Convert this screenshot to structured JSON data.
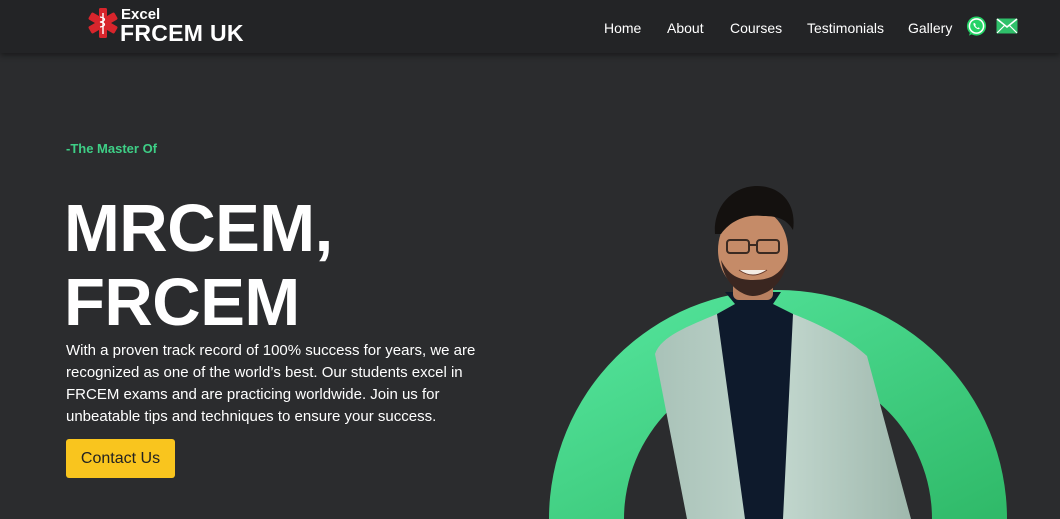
{
  "brand": {
    "line1": "Excel",
    "line2": "FRCEM UK"
  },
  "nav": {
    "items": [
      {
        "label": "Home",
        "name": "nav-home"
      },
      {
        "label": "About",
        "name": "nav-about"
      },
      {
        "label": "Courses",
        "name": "nav-courses"
      },
      {
        "label": "Testimonials",
        "name": "nav-testimonials"
      },
      {
        "label": "Gallery",
        "name": "nav-gallery"
      }
    ],
    "icons": [
      "whatsapp-icon",
      "email-icon"
    ]
  },
  "hero": {
    "tagline": "-The Master Of",
    "headline_line1": "MRCEM,",
    "headline_line2": "FRCEM",
    "description": "With a proven track record of 100% success for years, we are recognized as one of the world’s best. Our students excel in FRCEM exams and are practicing worldwide. Join us for unbeatable tips and techniques to ensure your success.",
    "cta_label": "Contact Us"
  },
  "colors": {
    "background": "#2b2c2e",
    "navbar": "#232426",
    "accent_green": "#3ecf86",
    "cta_yellow": "#f9c51e",
    "logo_red": "#d8252c"
  }
}
